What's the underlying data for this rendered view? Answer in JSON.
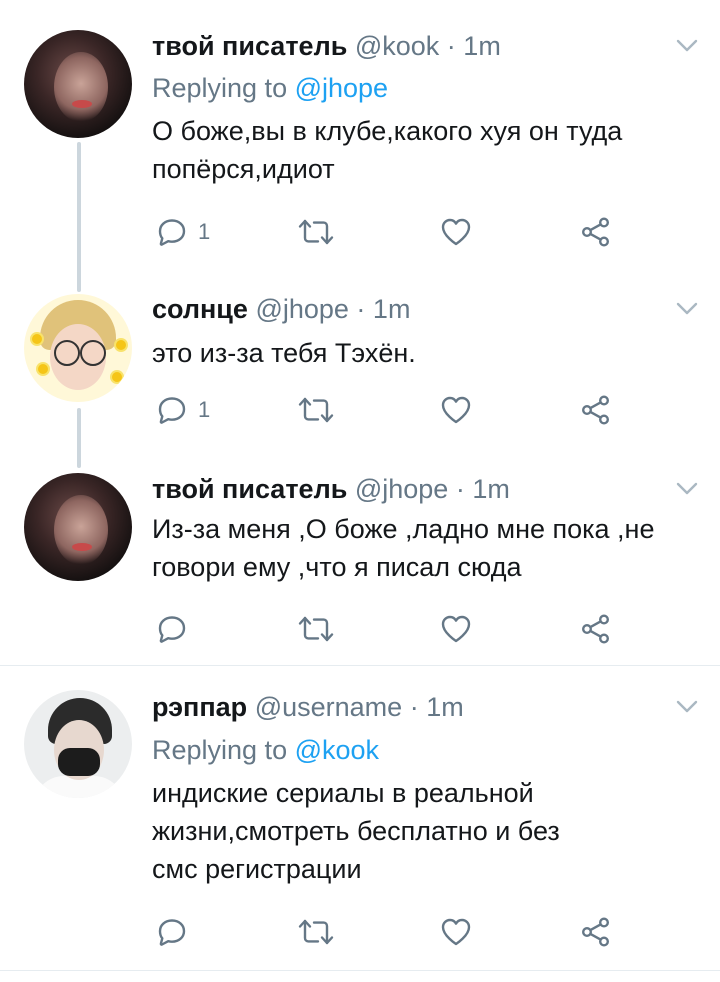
{
  "tweets": [
    {
      "name": "твой писатель",
      "handle": "@kook",
      "time": "1m",
      "replying_label": "Replying to ",
      "replying_handle": "@jhope",
      "text_lines": [
        "О боже,вы в клубе,какого хуя он туда",
        "попёрся,идиот"
      ],
      "reply_count": "1"
    },
    {
      "name": "солнце",
      "handle": "@jhope",
      "time": "1m",
      "text_lines": [
        "это из-за тебя Тэхён."
      ],
      "reply_count": "1"
    },
    {
      "name": "твой писатель",
      "handle": "@jhope",
      "time": "1m",
      "text_lines": [
        "Из-за меня ,О боже ,ладно мне пока ,не",
        "говори ему ,что я писал сюда"
      ],
      "reply_count": ""
    },
    {
      "name": "рэппар",
      "handle": "@username",
      "time": "1m",
      "replying_label": "Replying to ",
      "replying_handle": "@kook",
      "text_lines": [
        "индиские сериалы в реальной",
        "жизни,смотреть бесплатно и без",
        "смс регистрации"
      ],
      "reply_count": ""
    }
  ],
  "separator": " · ",
  "icons": {
    "reply": "reply-icon",
    "retweet": "retweet-icon",
    "like": "heart-icon",
    "share": "share-icon",
    "more": "chevron-down-icon"
  },
  "colors": {
    "link": "#1da1f2",
    "meta": "#657786",
    "icon": "#657786",
    "thread": "#ccd6dd"
  }
}
